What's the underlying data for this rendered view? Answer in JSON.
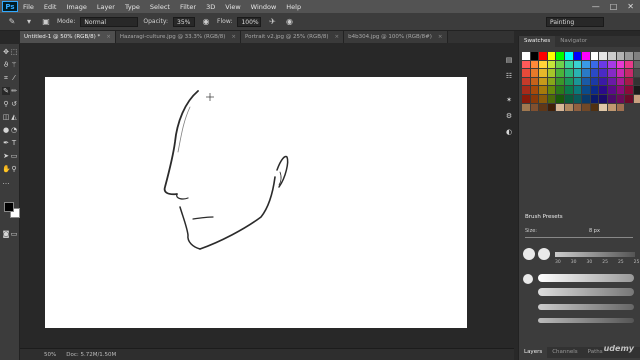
{
  "app": {
    "logo": "Ps"
  },
  "menu": [
    "File",
    "Edit",
    "Image",
    "Layer",
    "Type",
    "Select",
    "Filter",
    "3D",
    "View",
    "Window",
    "Help"
  ],
  "window_controls": [
    "—",
    "□",
    "✕"
  ],
  "options": {
    "mode_label": "Mode:",
    "mode_value": "Normal",
    "opacity_label": "Opacity:",
    "opacity_value": "35%",
    "flow_label": "Flow:",
    "flow_value": "100%",
    "workspace": "Painting"
  },
  "tabs": [
    {
      "label": "Untitled-1 @ 50% (RGB/8) *",
      "active": true
    },
    {
      "label": "Hazaragi-culture.jpg @ 33.3% (RGB/8)",
      "active": false
    },
    {
      "label": "Portrait v2.jpg @ 25% (RGB/8)",
      "active": false
    },
    {
      "label": "b4b304.jpg @ 100% (RGB/8#)",
      "active": false
    }
  ],
  "status": {
    "zoom": "50%",
    "doc": "Doc: 5.72M/1.50M"
  },
  "panels": {
    "swatches_tab": "Swatches",
    "navigator_tab": "Navigator",
    "brush_presets_title": "Brush Presets",
    "brush_size_label": "Size:",
    "brush_size_value": "8 px",
    "brush_numbers": [
      "30",
      "30",
      "30",
      "25",
      "25",
      "25",
      "36",
      "25",
      "36"
    ],
    "layers_tabs": [
      "Layers",
      "Channels",
      "Paths"
    ]
  },
  "watermark": "udemy",
  "colors": {
    "accent": "#31a8ff",
    "foreground": "#000000",
    "background": "#ffffff"
  }
}
